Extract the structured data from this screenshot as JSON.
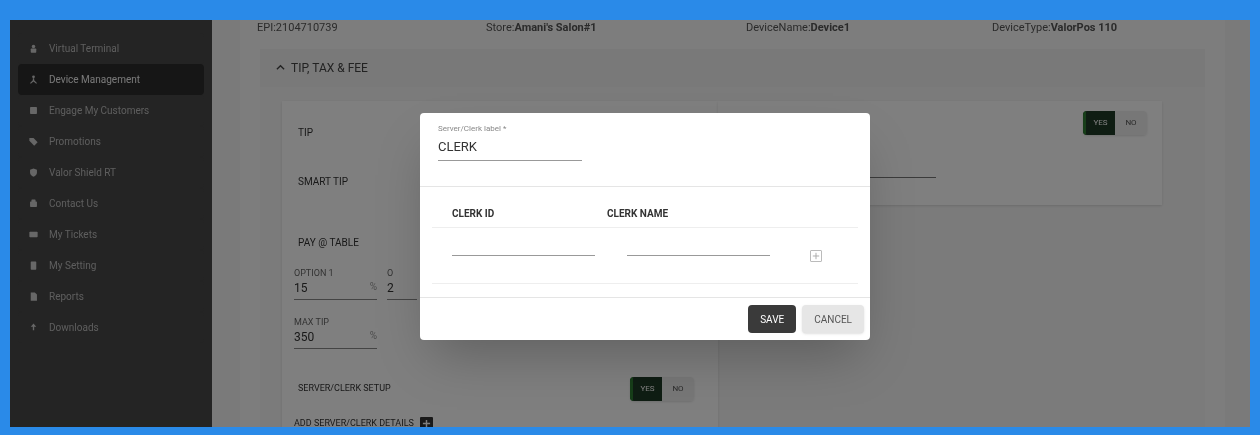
{
  "sidebar": {
    "items": [
      {
        "label": "Virtual Terminal",
        "selected": false
      },
      {
        "label": "Device Management",
        "selected": true
      },
      {
        "label": "Engage My Customers",
        "selected": false
      },
      {
        "label": "Promotions",
        "selected": false
      },
      {
        "label": "Valor Shield RT",
        "selected": false
      },
      {
        "label": "Contact Us",
        "selected": false
      },
      {
        "label": "My Tickets",
        "selected": false
      },
      {
        "label": "My Setting",
        "selected": false
      },
      {
        "label": "Reports",
        "selected": false
      },
      {
        "label": "Downloads",
        "selected": false
      }
    ]
  },
  "device_info": [
    "EPI:2104710739",
    "Store:**Amani's Salon#1**",
    "DeviceName:**Device1**",
    "DeviceType:**ValorPos 110**"
  ],
  "section": {
    "title": "TIP, TAX & FEE",
    "expanded": true,
    "left_card": {
      "tip_label": "TIP",
      "smart_tip_label": "SMART TIP",
      "pay_at_table_label": "PAY @ TABLE",
      "option_1": {
        "label": "OPTION 1",
        "value": "15",
        "suffix": "%"
      },
      "option_2": {
        "label": "O",
        "value": "2"
      },
      "max_tip": {
        "label": "MAX TIP",
        "value": "350",
        "suffix": "%"
      },
      "server_clerk_setup": {
        "label": "SERVER/CLERK SETUP",
        "options": [
          {
            "label": "YES",
            "selected": true
          },
          {
            "label": "NO",
            "selected": false
          }
        ]
      },
      "add_details_label": "ADD SERVER/CLERK DETAILS"
    },
    "right_card": {
      "toggle": {
        "options": [
          {
            "label": "YES",
            "selected": true
          },
          {
            "label": "NO",
            "selected": false
          }
        ]
      }
    }
  },
  "dialog": {
    "field": {
      "label": "Server/Clerk label *",
      "value": "CLERK"
    },
    "columns": [
      "CLERK ID",
      "CLERK NAME"
    ],
    "buttons": [
      {
        "label": "SAVE",
        "kind": "primary"
      },
      {
        "label": "CANCEL",
        "kind": "secondary"
      }
    ]
  }
}
